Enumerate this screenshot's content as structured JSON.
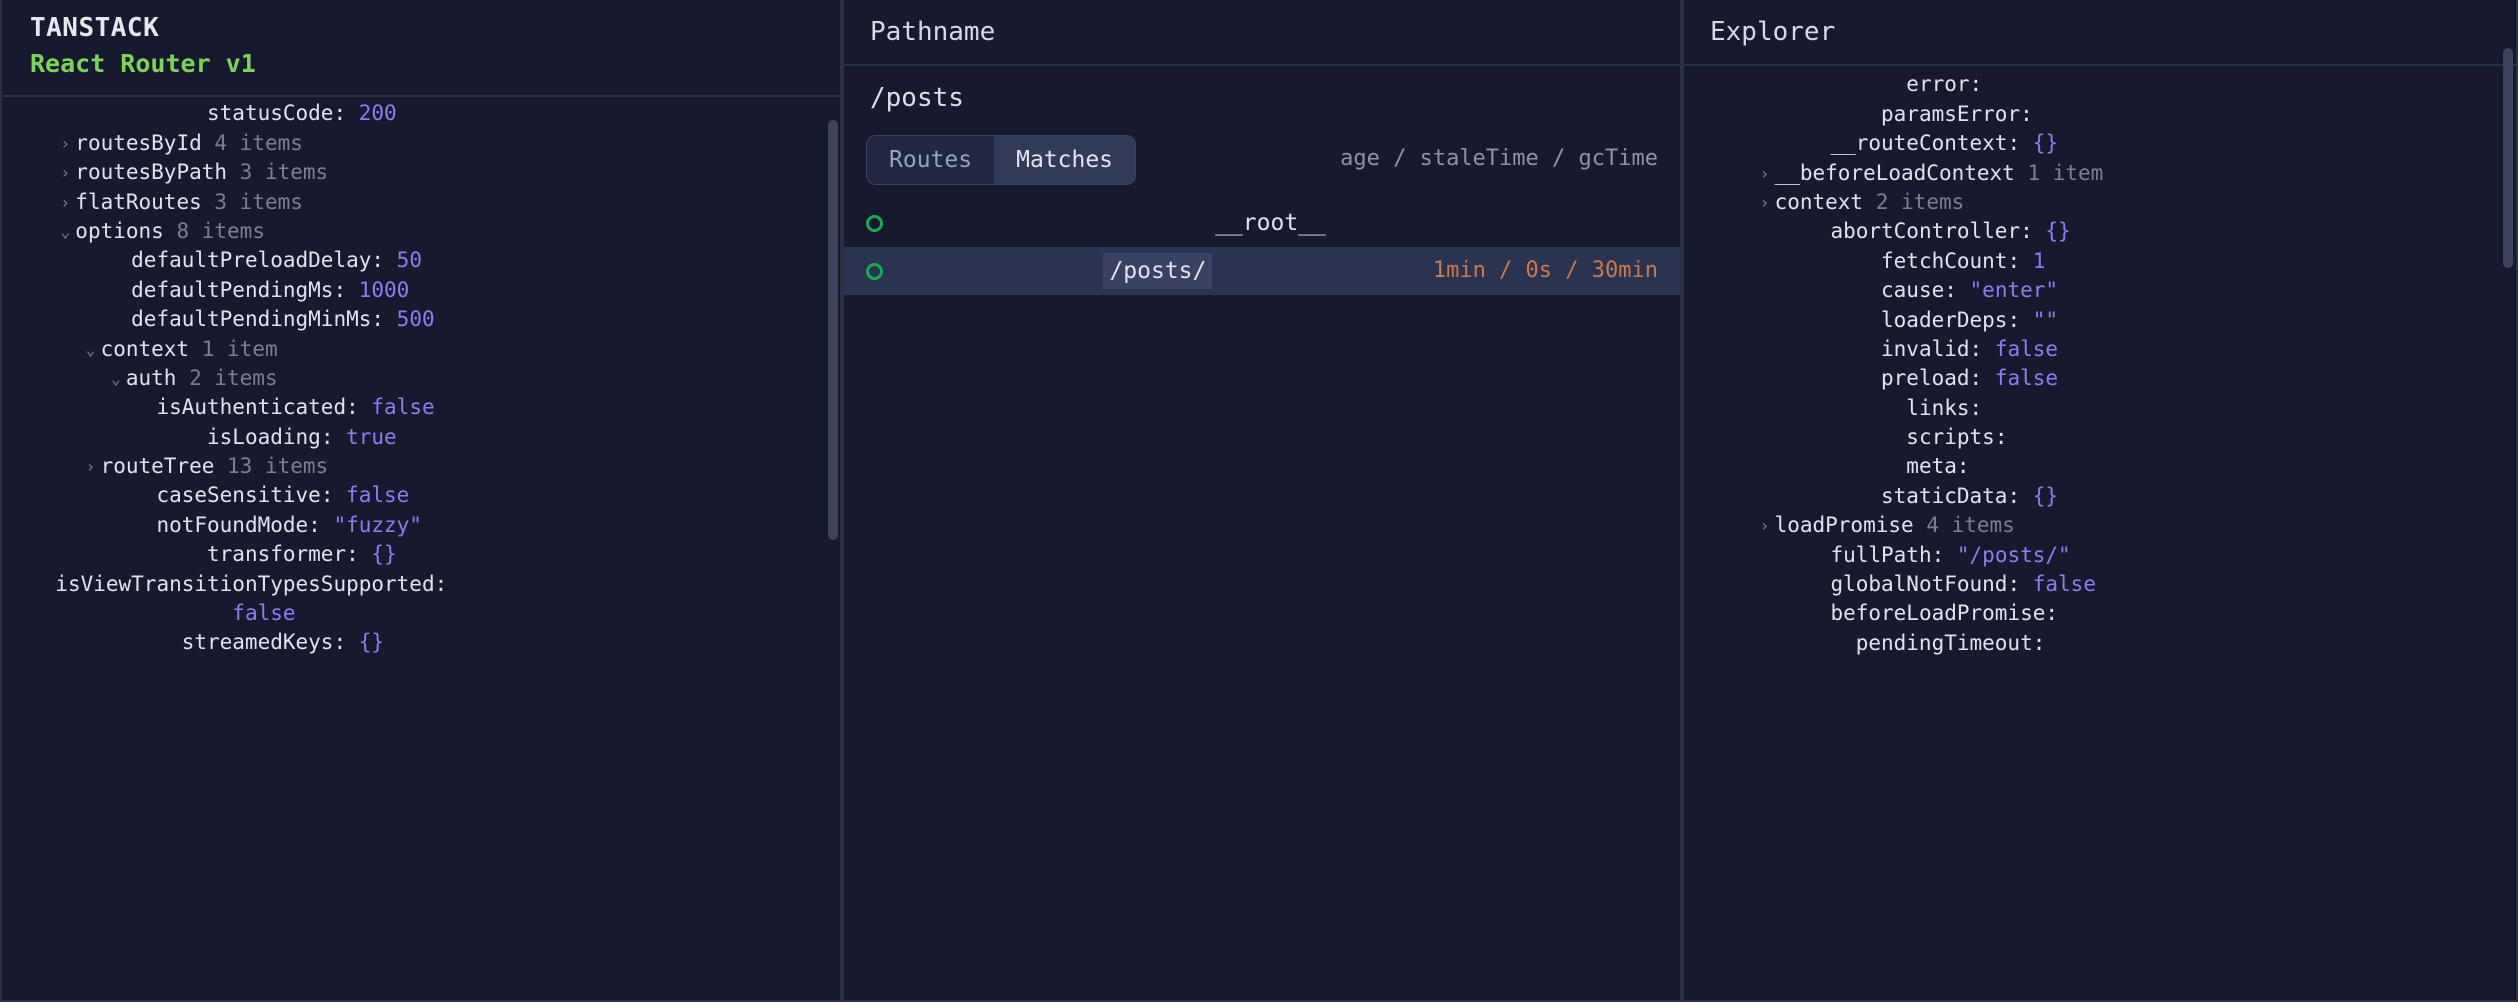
{
  "brand": {
    "top": "TANSTACK",
    "sub": "React Router v1"
  },
  "leftTree": [
    {
      "indent": 7,
      "chev": "",
      "key": "statusCode",
      "sep": ": ",
      "val": "200",
      "vclass": "num"
    },
    {
      "indent": 1,
      "chev": "›",
      "key": "routesById",
      "sep": " ",
      "val": "4 items",
      "vclass": "dim"
    },
    {
      "indent": 1,
      "chev": "›",
      "key": "routesByPath",
      "sep": " ",
      "val": "3 items",
      "vclass": "dim"
    },
    {
      "indent": 1,
      "chev": "›",
      "key": "flatRoutes",
      "sep": " ",
      "val": "3 items",
      "vclass": "dim"
    },
    {
      "indent": 1,
      "chev": "⌄",
      "key": "options",
      "sep": " ",
      "val": "8 items",
      "vclass": "dim"
    },
    {
      "indent": 4,
      "chev": "",
      "key": "defaultPreloadDelay",
      "sep": ": ",
      "val": "50",
      "vclass": "num"
    },
    {
      "indent": 4,
      "chev": "",
      "key": "defaultPendingMs",
      "sep": ": ",
      "val": "1000",
      "vclass": "num"
    },
    {
      "indent": 4,
      "chev": "",
      "key": "defaultPendingMinMs",
      "sep": ": ",
      "val": "500",
      "vclass": "num"
    },
    {
      "indent": 2,
      "chev": "⌄",
      "key": "context",
      "sep": " ",
      "val": "1 item",
      "vclass": "dim"
    },
    {
      "indent": 3,
      "chev": "⌄",
      "key": "auth",
      "sep": " ",
      "val": "2 items",
      "vclass": "dim"
    },
    {
      "indent": 5,
      "chev": "",
      "key": "isAuthenticated",
      "sep": ": ",
      "val": "false",
      "vclass": "bool"
    },
    {
      "indent": 7,
      "chev": "",
      "key": "isLoading",
      "sep": ": ",
      "val": "true",
      "vclass": "bool"
    },
    {
      "indent": 2,
      "chev": "›",
      "key": "routeTree",
      "sep": " ",
      "val": "13 items",
      "vclass": "dim"
    },
    {
      "indent": 5,
      "chev": "",
      "key": "caseSensitive",
      "sep": ": ",
      "val": "false",
      "vclass": "bool"
    },
    {
      "indent": 5,
      "chev": "",
      "key": "notFoundMode",
      "sep": ": ",
      "val": "\"fuzzy\"",
      "vclass": "str"
    },
    {
      "indent": 7,
      "chev": "",
      "key": "transformer",
      "sep": ": ",
      "val": "{}",
      "vclass": "brc"
    },
    {
      "indent": 1,
      "chev": "",
      "key": "isViewTransitionTypesSupported",
      "sep": ":",
      "val": "",
      "vclass": ""
    },
    {
      "indent": 8,
      "chev": "",
      "key": "",
      "sep": "",
      "val": "false",
      "vclass": "bool"
    },
    {
      "indent": 6,
      "chev": "",
      "key": "streamedKeys",
      "sep": ": ",
      "val": "{}",
      "vclass": "brc"
    }
  ],
  "mid": {
    "title": "Pathname",
    "pathname": "/posts",
    "tabs": {
      "routes": "Routes",
      "matches": "Matches",
      "active": "matches"
    },
    "metaHeader": "age / staleTime / gcTime",
    "matches": [
      {
        "label": "__root__",
        "times": "",
        "selected": false,
        "hl": false
      },
      {
        "label": "/posts/",
        "times": "1min / 0s / 30min",
        "selected": true,
        "hl": true
      }
    ]
  },
  "right": {
    "title": "Explorer",
    "tree": [
      {
        "indent": 8,
        "chev": "",
        "key": "error",
        "sep": ":",
        "val": "",
        "vclass": ""
      },
      {
        "indent": 7,
        "chev": "",
        "key": "paramsError",
        "sep": ":",
        "val": "",
        "vclass": ""
      },
      {
        "indent": 5,
        "chev": "",
        "key": "__routeContext",
        "sep": ": ",
        "val": "{}",
        "vclass": "brc"
      },
      {
        "indent": 2,
        "chev": "›",
        "key": "__beforeLoadContext",
        "sep": " ",
        "val": "1 item",
        "vclass": "dim"
      },
      {
        "indent": 2,
        "chev": "›",
        "key": "context",
        "sep": " ",
        "val": "2 items",
        "vclass": "dim"
      },
      {
        "indent": 5,
        "chev": "",
        "key": "abortController",
        "sep": ": ",
        "val": "{}",
        "vclass": "brc"
      },
      {
        "indent": 7,
        "chev": "",
        "key": "fetchCount",
        "sep": ": ",
        "val": "1",
        "vclass": "num"
      },
      {
        "indent": 7,
        "chev": "",
        "key": "cause",
        "sep": ": ",
        "val": "\"enter\"",
        "vclass": "str"
      },
      {
        "indent": 7,
        "chev": "",
        "key": "loaderDeps",
        "sep": ": ",
        "val": "\"\"",
        "vclass": "str"
      },
      {
        "indent": 7,
        "chev": "",
        "key": "invalid",
        "sep": ": ",
        "val": "false",
        "vclass": "bool"
      },
      {
        "indent": 7,
        "chev": "",
        "key": "preload",
        "sep": ": ",
        "val": "false",
        "vclass": "bool"
      },
      {
        "indent": 8,
        "chev": "",
        "key": "links",
        "sep": ":",
        "val": "",
        "vclass": ""
      },
      {
        "indent": 8,
        "chev": "",
        "key": "scripts",
        "sep": ":",
        "val": "",
        "vclass": ""
      },
      {
        "indent": 8,
        "chev": "",
        "key": "meta",
        "sep": ":",
        "val": "",
        "vclass": ""
      },
      {
        "indent": 7,
        "chev": "",
        "key": "staticData",
        "sep": ": ",
        "val": "{}",
        "vclass": "brc"
      },
      {
        "indent": 2,
        "chev": "›",
        "key": "loadPromise",
        "sep": " ",
        "val": "4 items",
        "vclass": "dim"
      },
      {
        "indent": 5,
        "chev": "",
        "key": "fullPath",
        "sep": ": ",
        "val": "\"/posts/\"",
        "vclass": "str"
      },
      {
        "indent": 5,
        "chev": "",
        "key": "globalNotFound",
        "sep": ": ",
        "val": "false",
        "vclass": "bool"
      },
      {
        "indent": 5,
        "chev": "",
        "key": "beforeLoadPromise",
        "sep": ":",
        "val": "",
        "vclass": ""
      },
      {
        "indent": 6,
        "chev": "",
        "key": "pendingTimeout",
        "sep": ":",
        "val": "",
        "vclass": ""
      }
    ]
  }
}
